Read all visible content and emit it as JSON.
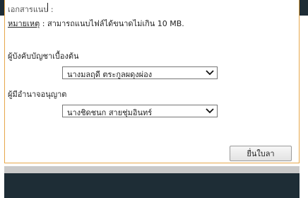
{
  "form": {
    "cut_label": "เอกสารแนบ :",
    "note_prefix": "หมายเหตุ",
    "note_text": " : สามารถแนบไฟล์ได้ขนาดไม่เกิน 10 MB.",
    "supervisor_label": "ผู้บังคับบัญชาเบื้องต้น",
    "supervisor_value": "นางมลฤดี ตระกูลผดุงผ่อง",
    "approver_label": "ผู้มีอำนาจอนุญาต",
    "approver_value": "นางชิดชนก สายชุ่มอินทร์",
    "submit_label": "ยื่นใบลา"
  },
  "icons": {
    "dropdown": "chevron-down-icon"
  },
  "colors": {
    "dark_bar": "#1e2d36",
    "panel_border": "#e7a74a"
  }
}
